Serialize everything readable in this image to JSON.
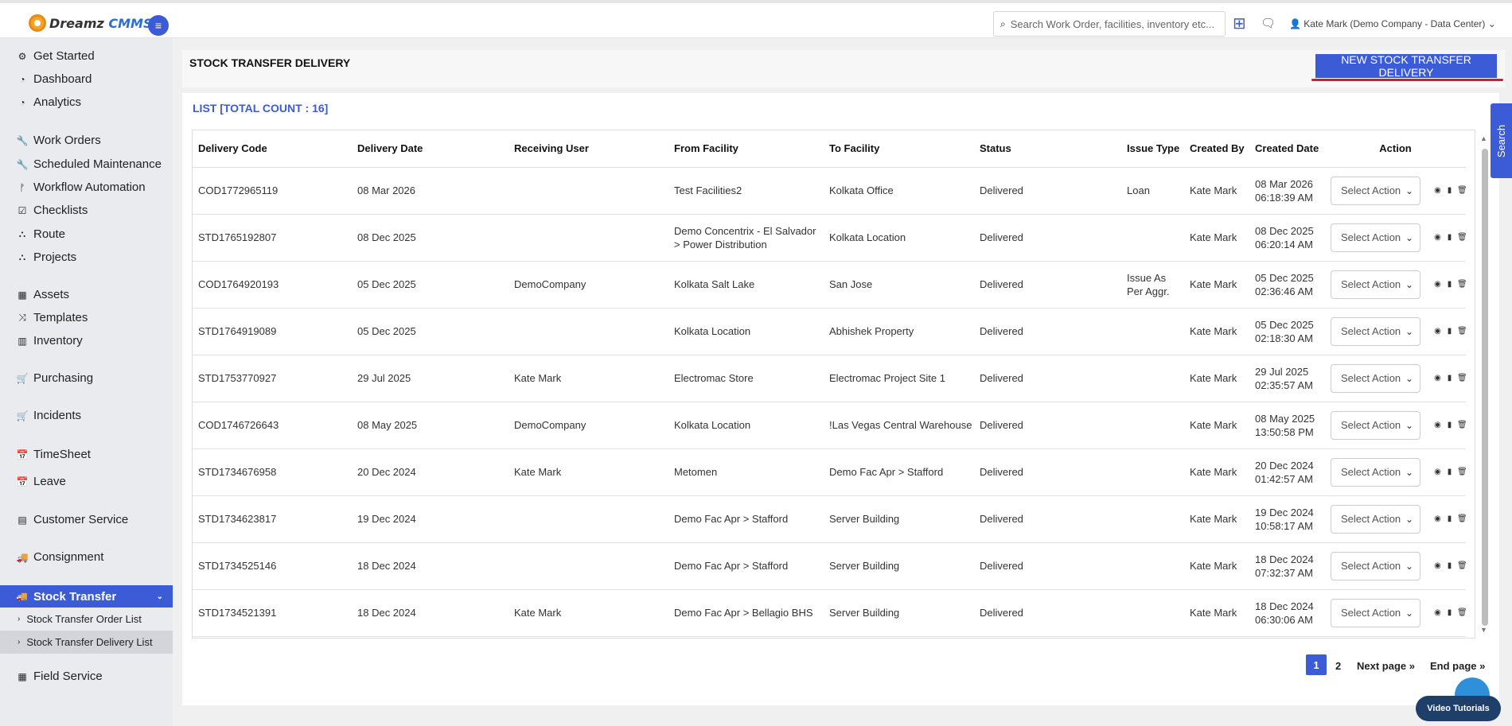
{
  "brand": {
    "name_main": "Dreamz",
    "name_accent": "CMMS"
  },
  "header": {
    "search_placeholder": "Search Work Order, facilities, inventory etc...",
    "user_label": "Kate Mark (Demo Company - Data Center)",
    "user_caret": "⌄"
  },
  "sidebar": {
    "items": [
      {
        "label": "Get Started",
        "icon": "gears-icon"
      },
      {
        "label": "Dashboard",
        "icon": "dashboard-icon"
      },
      {
        "label": "Analytics",
        "icon": "analytics-icon"
      },
      {
        "label": "Work Orders",
        "icon": "wrench-icon"
      },
      {
        "label": "Scheduled Maintenance",
        "icon": "wrench-icon"
      },
      {
        "label": "Workflow Automation",
        "icon": "flow-icon"
      },
      {
        "label": "Checklists",
        "icon": "checkbox-icon"
      },
      {
        "label": "Route",
        "icon": "route-icon"
      },
      {
        "label": "Projects",
        "icon": "projects-icon"
      },
      {
        "label": "Assets",
        "icon": "assets-icon"
      },
      {
        "label": "Templates",
        "icon": "shuffle-icon"
      },
      {
        "label": "Inventory",
        "icon": "briefcase-icon"
      },
      {
        "label": "Purchasing",
        "icon": "cart-icon"
      },
      {
        "label": "Incidents",
        "icon": "cart-icon"
      },
      {
        "label": "TimeSheet",
        "icon": "calendar-icon"
      },
      {
        "label": "Leave",
        "icon": "calendar-icon"
      },
      {
        "label": "Customer Service",
        "icon": "document-icon"
      },
      {
        "label": "Consignment",
        "icon": "truck-icon"
      },
      {
        "label": "Field Service",
        "icon": "assets-icon"
      }
    ],
    "active": {
      "label": "Stock Transfer",
      "icon": "truck-icon"
    },
    "subitems": [
      {
        "label": "Stock Transfer Order List"
      },
      {
        "label": "Stock Transfer Delivery List"
      }
    ]
  },
  "page": {
    "title": "STOCK TRANSFER DELIVERY",
    "new_button": "NEW STOCK TRANSFER DELIVERY",
    "list_title": "LIST [TOTAL COUNT : 16]"
  },
  "table": {
    "columns": [
      "Delivery Code",
      "Delivery Date",
      "Receiving User",
      "From Facility",
      "To Facility",
      "Status",
      "Issue Type",
      "Created By",
      "Created Date",
      "Action"
    ],
    "select_label": "Select Action",
    "rows": [
      {
        "code": "COD1772965119",
        "date": "08 Mar 2026",
        "user": "",
        "from": "Test Facilities2",
        "to": "Kolkata Office",
        "status": "Delivered",
        "issue": "Loan",
        "by": "Kate Mark",
        "created_d": "08 Mar 2026",
        "created_t": "06:18:39 AM"
      },
      {
        "code": "STD1765192807",
        "date": "08 Dec 2025",
        "user": "",
        "from": "Demo Concentrix - El Salvador > Power Distribution",
        "to": "Kolkata Location",
        "status": "Delivered",
        "issue": "",
        "by": "Kate Mark",
        "created_d": "08 Dec 2025",
        "created_t": "06:20:14 AM"
      },
      {
        "code": "COD1764920193",
        "date": "05 Dec 2025",
        "user": "DemoCompany",
        "from": "Kolkata Salt Lake",
        "to": "San Jose",
        "status": "Delivered",
        "issue": "Issue As Per Aggr.",
        "by": "Kate Mark",
        "created_d": "05 Dec 2025",
        "created_t": "02:36:46 AM"
      },
      {
        "code": "STD1764919089",
        "date": "05 Dec 2025",
        "user": "",
        "from": "Kolkata Location",
        "to": "Abhishek Property",
        "status": "Delivered",
        "issue": "",
        "by": "Kate Mark",
        "created_d": "05 Dec 2025",
        "created_t": "02:18:30 AM"
      },
      {
        "code": "STD1753770927",
        "date": "29 Jul 2025",
        "user": "Kate Mark",
        "from": "Electromac Store",
        "to": "Electromac Project Site 1",
        "status": "Delivered",
        "issue": "",
        "by": "Kate Mark",
        "created_d": "29 Jul 2025",
        "created_t": "02:35:57 AM"
      },
      {
        "code": "COD1746726643",
        "date": "08 May 2025",
        "user": "DemoCompany",
        "from": "Kolkata Location",
        "to": "!Las Vegas Central Warehouse",
        "status": "Delivered",
        "issue": "",
        "by": "Kate Mark",
        "created_d": "08 May 2025",
        "created_t": "13:50:58 PM"
      },
      {
        "code": "STD1734676958",
        "date": "20 Dec 2024",
        "user": "Kate Mark",
        "from": "Metomen",
        "to": "Demo Fac Apr > Stafford",
        "status": "Delivered",
        "issue": "",
        "by": "Kate Mark",
        "created_d": "20 Dec 2024",
        "created_t": "01:42:57 AM"
      },
      {
        "code": "STD1734623817",
        "date": "19 Dec 2024",
        "user": "",
        "from": "Demo Fac Apr > Stafford",
        "to": "Server Building",
        "status": "Delivered",
        "issue": "",
        "by": "Kate Mark",
        "created_d": "19 Dec 2024",
        "created_t": "10:58:17 AM"
      },
      {
        "code": "STD1734525146",
        "date": "18 Dec 2024",
        "user": "",
        "from": "Demo Fac Apr > Stafford",
        "to": "Server Building",
        "status": "Delivered",
        "issue": "",
        "by": "Kate Mark",
        "created_d": "18 Dec 2024",
        "created_t": "07:32:37 AM"
      },
      {
        "code": "STD1734521391",
        "date": "18 Dec 2024",
        "user": "Kate Mark",
        "from": "Demo Fac Apr > Bellagio BHS",
        "to": "Server Building",
        "status": "Delivered",
        "issue": "",
        "by": "Kate Mark",
        "created_d": "18 Dec 2024",
        "created_t": "06:30:06 AM"
      }
    ]
  },
  "pagination": {
    "current": "1",
    "page2": "2",
    "next": "Next page »",
    "end": "End page »"
  },
  "floating": {
    "search_tab": "Search",
    "video_tutorials": "Video Tutorials"
  },
  "colors": {
    "primary": "#3c5bd6",
    "accent_red": "#c81e3c",
    "help_blue": "#2f8fd8",
    "navy": "#1d3f6a"
  }
}
